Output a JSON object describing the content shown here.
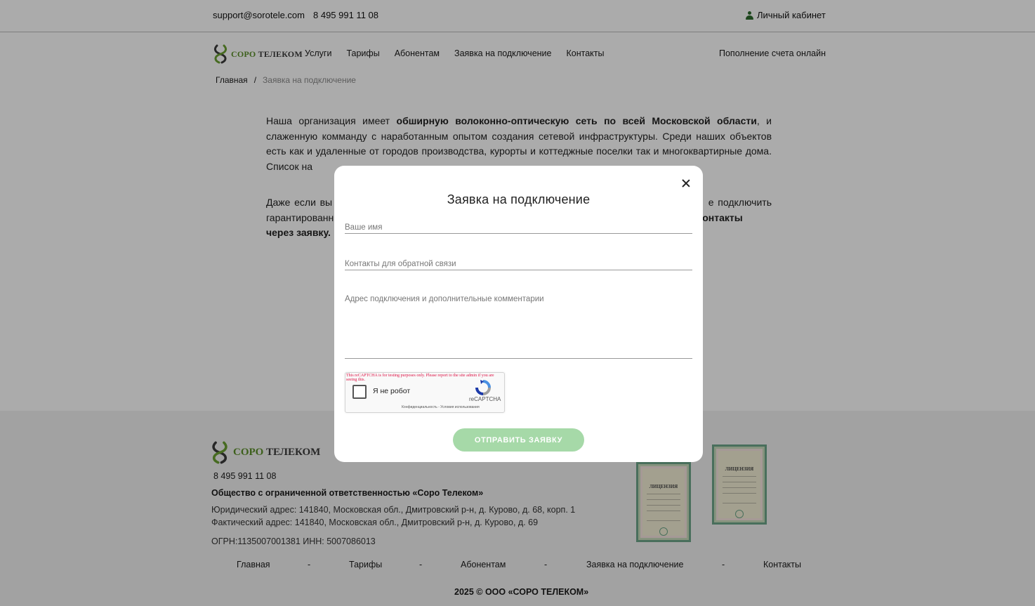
{
  "topbar": {
    "email": "support@sorotele.com",
    "phone": "8 495 991 11 08",
    "cabinet": "Личный кабинет"
  },
  "logo": {
    "part1": "СОРО",
    "part2": "ТЕЛЕКОМ"
  },
  "nav": {
    "items": [
      "Услуги",
      "Тарифы",
      "Абонентам",
      "Заявка на подключение",
      "Контакты"
    ],
    "topup": "Пополнение счета онлайн"
  },
  "breadcrumb": {
    "home": "Главная",
    "separator": "/",
    "current": "Заявка на подключение"
  },
  "content": {
    "p1_start": "Наша организация имеет ",
    "p1_bold": "обширную волоконно-оптическую сеть по всей Московской области",
    "p1_end": ", и слаженную комманду с наработанным опытом создания сетевой инфраструктуры. Среди наших объектов есть как и удаленные от городов производства, курорты и коттеджные поселки так и многоквартирные дома. Список на",
    "p2_start": "Даже если вы",
    "p2_mid": " е подключить гарантированн",
    "p2_bold": "онтакты через заявку."
  },
  "modal": {
    "title": "Заявка на подключение",
    "name_placeholder": "Ваше имя",
    "contact_placeholder": "Контакты для обратной связи",
    "address_placeholder": "Адрес подключения и дополнительные комментарии",
    "submit_label": "ОТПРАВИТЬ ЗАЯВКУ"
  },
  "captcha": {
    "warning": "This reCAPTCHA is for testing purposes only. Please report to the site admin if you are seeing this.",
    "label": "Я не робот",
    "brand": "reCAPTCHA",
    "terms": "Конфиденциальность - Условия использования"
  },
  "footer": {
    "logo_part1": "СОРО",
    "logo_part2": "ТЕЛЕКОМ",
    "phone": "8 495 991 11 08",
    "company": "Общество с ограниченной ответственностью «Соро Телеком»",
    "address_legal": "Юридический адрес: 141840, Московская обл., Дмитровский р-н, д. Курово, д. 68, корп. 1",
    "address_actual": "Фактический адрес: 141840, Московская обл., Дмитровский р-н, д. Курово, д. 69",
    "ogrn": "ОГРН:1135007001381 ИНН: 5007086013",
    "menu": [
      "Главная",
      "Тарифы",
      "Абонентам",
      "Заявка на подключение",
      "Контакты"
    ],
    "menu_separator": "-",
    "copyright": "2025 © ООО «СОРО ТЕЛЕКОМ»",
    "cert_title": "ЛИЦЕНЗИЯ"
  },
  "colors": {
    "brand_green": "#5c8f2a",
    "submit_bg": "#a6d9a8",
    "overlay": "rgba(0,0,0,0.33)"
  }
}
